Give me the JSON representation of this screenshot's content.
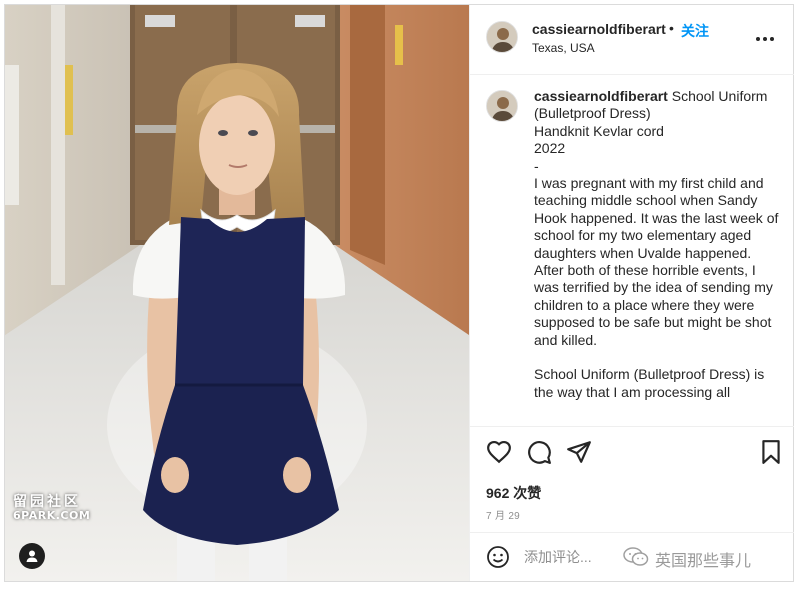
{
  "photo": {
    "watermark_cn": "留园社区",
    "watermark_en": "6PARK.COM"
  },
  "header": {
    "username": "cassiearnoldfiberart",
    "separator": "•",
    "follow_label": "关注",
    "location": "Texas, USA"
  },
  "caption": {
    "username": "cassiearnoldfiberart",
    "lines_before_gap": [
      "School Uniform (Bulletproof Dress)",
      "Handknit Kevlar cord",
      "2022",
      "-",
      "I was pregnant with my first child and teaching middle school when Sandy Hook happened. It was the last week of school for my two elementary aged daughters when Uvalde happened. After both of these horrible events, I was terrified by the idea of sending my children to a place where they were supposed to be safe but might be shot and killed."
    ],
    "line_after_gap": "School Uniform (Bulletproof Dress) is the way that I am processing all"
  },
  "actions": {
    "icons": [
      "heart-icon",
      "comment-icon",
      "share-icon",
      "bookmark-icon"
    ],
    "likes": "962 次赞",
    "date": "7 月 29"
  },
  "comment": {
    "placeholder": "添加评论..."
  },
  "brand": {
    "text": "英国那些事儿"
  },
  "colors": {
    "follow": "#0095f6",
    "text": "#262626",
    "muted": "#8e8e8e",
    "border": "#dbdbdb",
    "dress": "#1e2556"
  }
}
